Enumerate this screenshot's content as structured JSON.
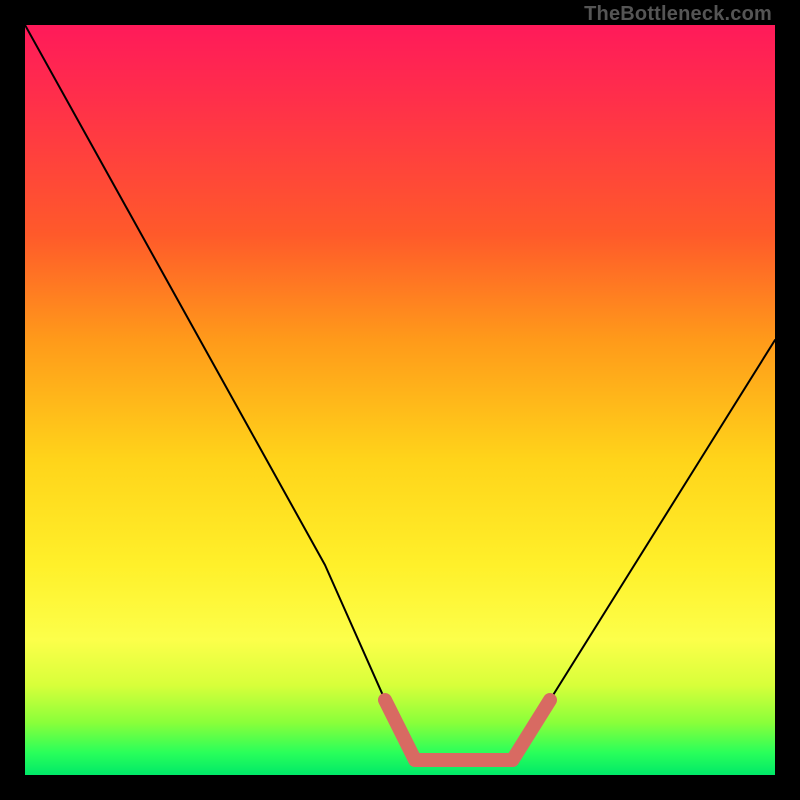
{
  "watermark": "TheBottleneck.com",
  "chart_data": {
    "type": "line",
    "title": "",
    "xlabel": "",
    "ylabel": "",
    "xlim": [
      0,
      100
    ],
    "ylim": [
      0,
      100
    ],
    "series": [
      {
        "name": "bottleneck-curve",
        "x": [
          0,
          10,
          20,
          30,
          40,
          48,
          52,
          55,
          60,
          65,
          70,
          80,
          90,
          100
        ],
        "values": [
          100,
          82,
          64,
          46,
          28,
          10,
          2,
          2,
          2,
          2,
          10,
          26,
          42,
          58
        ]
      }
    ],
    "highlight": {
      "name": "optimal-zone",
      "x": [
        48,
        52,
        55,
        60,
        65,
        70
      ],
      "values": [
        10,
        2,
        2,
        2,
        2,
        10
      ],
      "color": "#d86a62"
    },
    "background_gradient": {
      "top": "#ff1a5a",
      "mid": "#ffd41a",
      "bottom": "#00e968"
    }
  }
}
